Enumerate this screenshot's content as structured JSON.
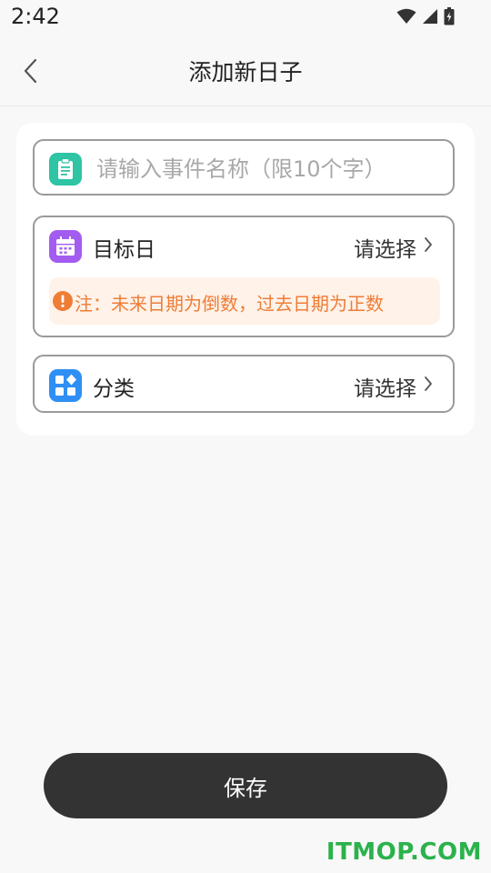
{
  "status_bar": {
    "time": "2:42",
    "icons": [
      "wifi-icon",
      "cell-signal-icon",
      "battery-charging-icon"
    ]
  },
  "nav": {
    "title": "添加新日子",
    "back_icon": "chevron-left-icon"
  },
  "form": {
    "name_field": {
      "icon": "clipboard-icon",
      "icon_color": "#2ec4a4",
      "placeholder": "请输入事件名称（限10个字）",
      "value": ""
    },
    "target_day": {
      "icon": "calendar-icon",
      "icon_color": "#a35cf0",
      "label": "目标日",
      "value": "请选择",
      "note": "注：未来日期为倒数，过去日期为正数",
      "note_icon": "warning-icon",
      "note_color": "#ee7d36"
    },
    "category": {
      "icon": "apps-grid-icon",
      "icon_color": "#2f8ff5",
      "label": "分类",
      "value": "请选择"
    }
  },
  "save_button": {
    "label": "保存"
  },
  "watermark": {
    "text": "ITMOP.COM",
    "color": "#2bb24c"
  },
  "colors": {
    "background": "#f8f8f8",
    "card": "#ffffff",
    "border": "#9a9a9a",
    "button": "#333333"
  }
}
